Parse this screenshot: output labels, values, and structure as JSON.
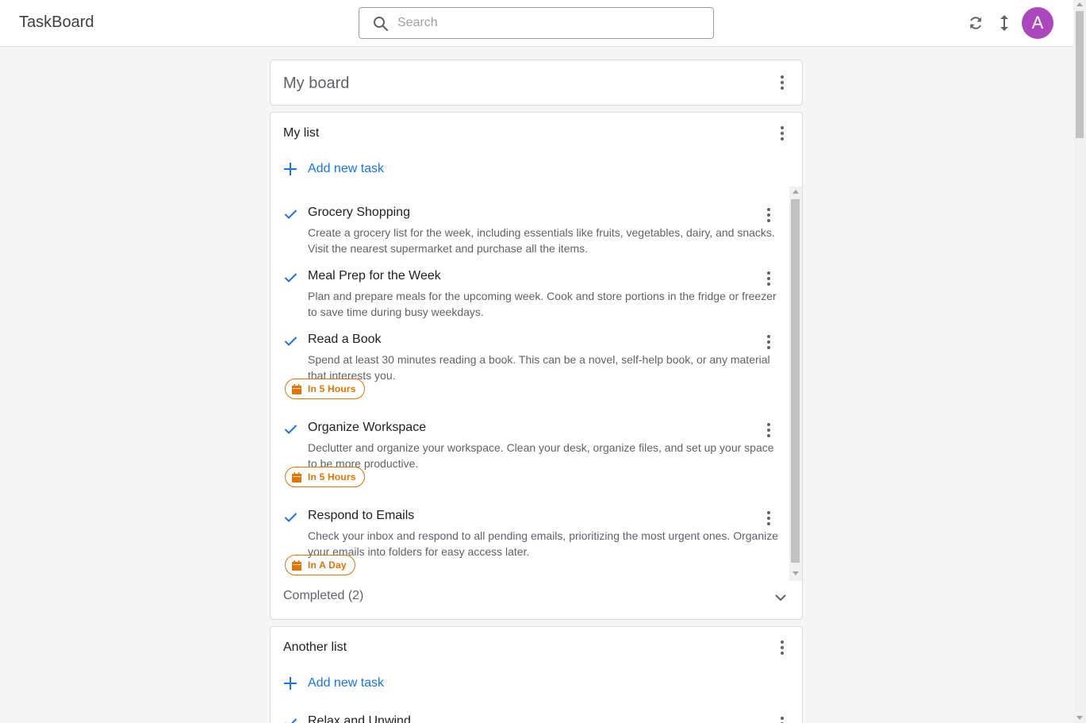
{
  "app": {
    "title": "TaskBoard"
  },
  "search": {
    "placeholder": "Search"
  },
  "header": {
    "avatar_letter": "A",
    "avatar_color": "#ab47bc"
  },
  "board": {
    "title": "My board"
  },
  "lists": [
    {
      "title": "My list",
      "add_label": "Add new task",
      "tasks": [
        {
          "title": "Grocery Shopping",
          "description": "Create a grocery list for the week, including essentials like fruits, vegetables, dairy, and snacks. Visit the nearest supermarket and purchase all the items.",
          "due": ""
        },
        {
          "title": "Meal Prep for the Week",
          "description": "Plan and prepare meals for the upcoming week. Cook and store portions in the fridge or freezer to save time during busy weekdays.",
          "due": ""
        },
        {
          "title": "Read a Book",
          "description": "Spend at least 30 minutes reading a book. This can be a novel, self-help book, or any material that interests you.",
          "due": "In 5 Hours"
        },
        {
          "title": "Organize Workspace",
          "description": "Declutter and organize your workspace. Clean your desk, organize files, and set up your space to be more productive.",
          "due": "In 5 Hours"
        },
        {
          "title": "Respond to Emails",
          "description": "Check your inbox and respond to all pending emails, prioritizing the most urgent ones. Organize your emails into folders for easy access later.",
          "due": "In A Day"
        }
      ],
      "completed_label": "Completed (2)"
    },
    {
      "title": "Another list",
      "add_label": "Add new task",
      "tasks": [
        {
          "title": "Relax and Unwind"
        }
      ]
    }
  ],
  "colors": {
    "accent": "#1a73e8",
    "due_chip": "#e37400"
  }
}
